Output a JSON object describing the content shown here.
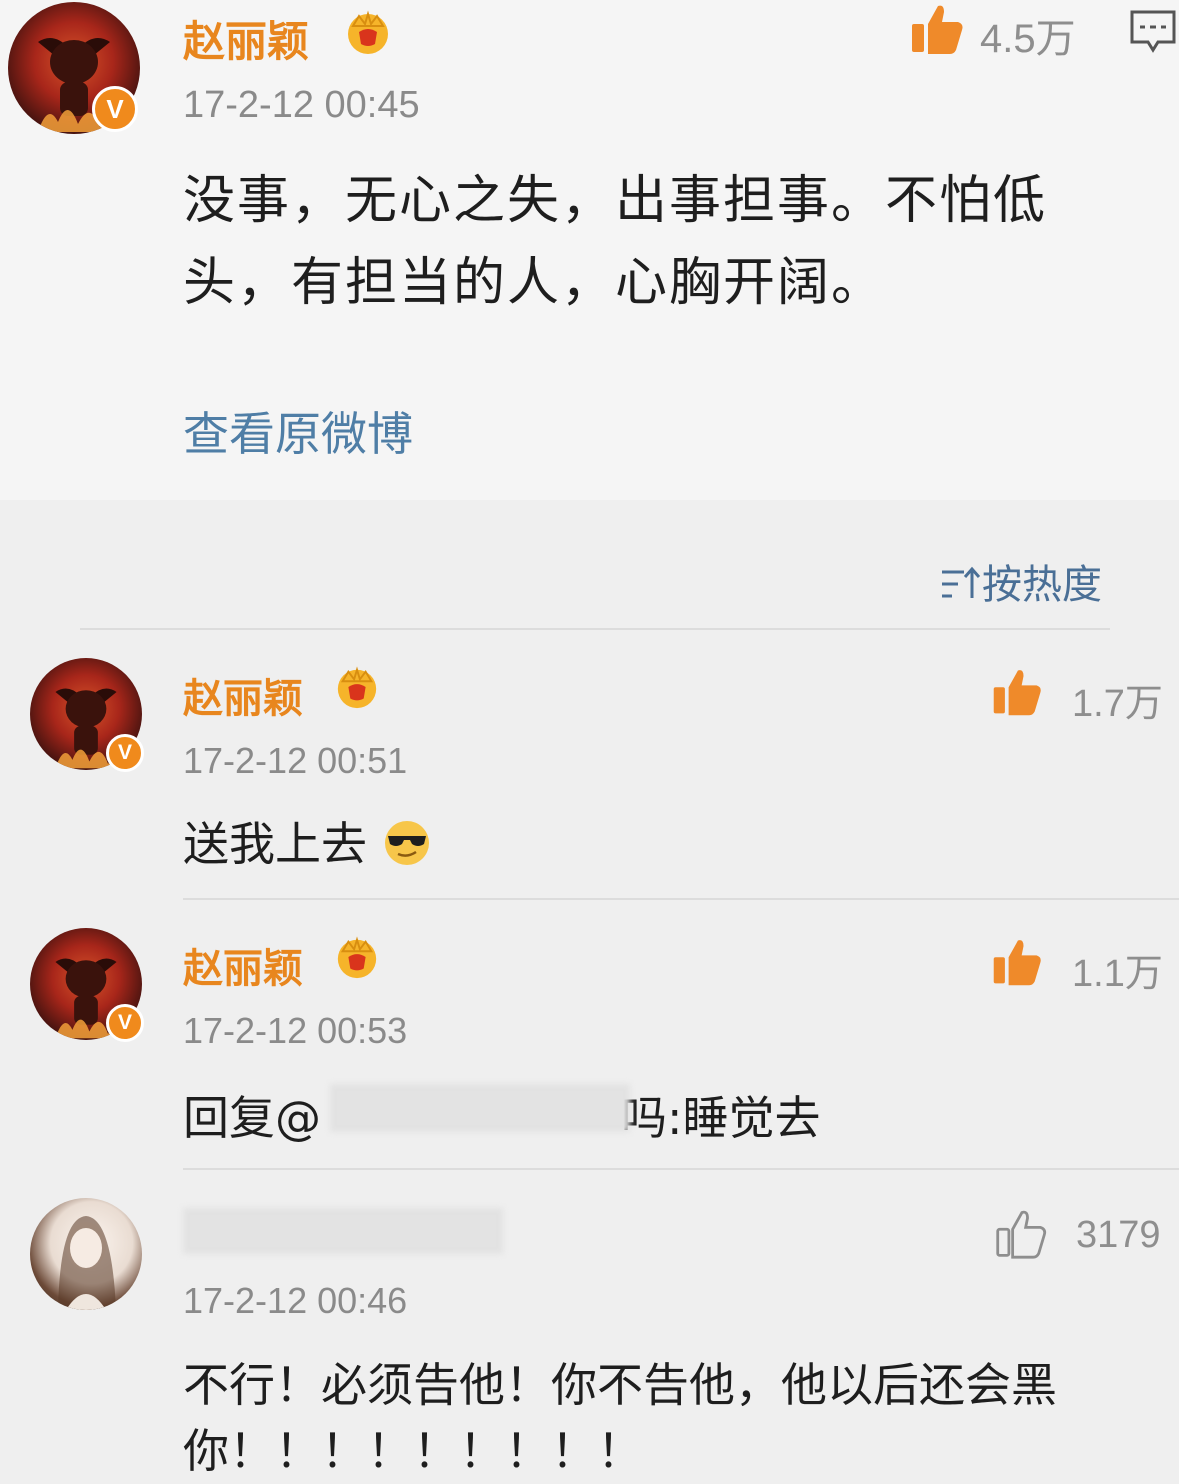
{
  "post": {
    "author": "赵丽颖",
    "time": "17-2-12 00:45",
    "likes": "4.5万",
    "text": "没事，无心之失，出事担事。不怕低头，有担当的人，心胸开阔。",
    "view_original": "查看原微博",
    "verified_mark": "V",
    "icons": [
      "crown-icon",
      "thumbs-up-icon",
      "comment-icon"
    ]
  },
  "sort": {
    "label": "按热度",
    "icon": "sort-icon"
  },
  "comments": [
    {
      "author": "赵丽颖",
      "time": "17-2-12 00:51",
      "likes": "1.7万",
      "text": "送我上去",
      "emoji": "cool-emoji"
    },
    {
      "author": "赵丽颖",
      "time": "17-2-12 00:53",
      "likes": "1.1万",
      "text_prefix": "回复@",
      "text_suffix": "吗:睡觉去"
    },
    {
      "author": "",
      "time": "17-2-12 00:46",
      "likes": "3179",
      "text": "不行！必须告他！你不告他，他以后还会黑你！！！！！！！！！"
    }
  ],
  "colors": {
    "name": "#e8861e",
    "link": "#4f7ea6",
    "time": "#8a8a8a",
    "background": "#efefef"
  }
}
